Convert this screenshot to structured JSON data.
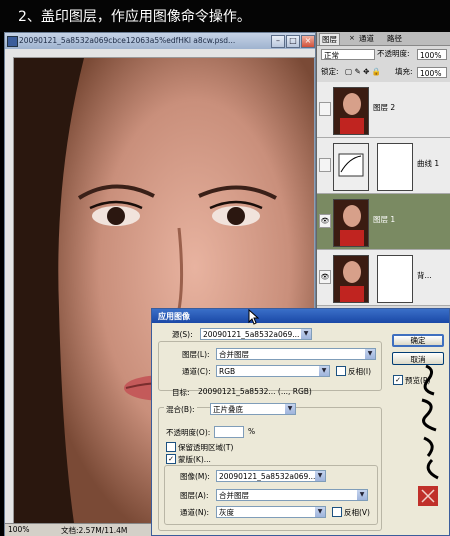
{
  "banner": {
    "text": "2、盖印图层，作应用图像命令操作。"
  },
  "document": {
    "title": "20090121_5a8532a069cbce12063a5%edfHKl a8cw.psd...",
    "zoom": "100%",
    "doc_info": "文档:2.57M/11.4M"
  },
  "layers_panel": {
    "tabs": [
      "图层",
      "通道",
      "路径"
    ],
    "close_glyph": "×",
    "blend_mode": "正常",
    "opacity_label": "不透明度:",
    "opacity": "100%",
    "lock_label": "锁定:",
    "fill_label": "填充:",
    "fill": "100%",
    "layers": [
      {
        "name": "图层 2",
        "visible": false,
        "selected": false,
        "kind": "photo"
      },
      {
        "name": "曲线 1",
        "visible": false,
        "selected": false,
        "kind": "adjustment"
      },
      {
        "name": "图层 1",
        "visible": true,
        "selected": true,
        "kind": "photo"
      },
      {
        "name": "背...",
        "visible": true,
        "selected": false,
        "kind": "photo"
      }
    ]
  },
  "dialog": {
    "title": "应用图像",
    "source_label": "源(S):",
    "source_value": "20090121_5a8532a069...",
    "layer_label": "图层(L):",
    "layer_value": "合并图层",
    "channel_label": "通道(C):",
    "channel_value": "RGB",
    "invert_label": "反相(I)",
    "target_label": "目标:",
    "target_value": "20090121_5a8532... (..., RGB)",
    "blending_label": "混合(B):",
    "blending_value": "正片叠底",
    "opacity_label": "不透明度(O):",
    "opacity_value": "",
    "opacity_unit": "%",
    "preserve_label": "保留透明区域(T)",
    "mask_label": "蒙版(K)...",
    "mask_image_label": "图像(M):",
    "mask_image_value": "20090121_5a8532a069...",
    "mask_layer_label": "图层(A):",
    "mask_layer_value": "合并图层",
    "mask_channel_label": "通道(N):",
    "mask_channel_value": "灰度",
    "mask_invert_label": "反相(V)",
    "ok_label": "确定",
    "cancel_label": "取消",
    "preview_label": "预览(P)",
    "check_mark": "✓",
    "arrow": "▼"
  }
}
